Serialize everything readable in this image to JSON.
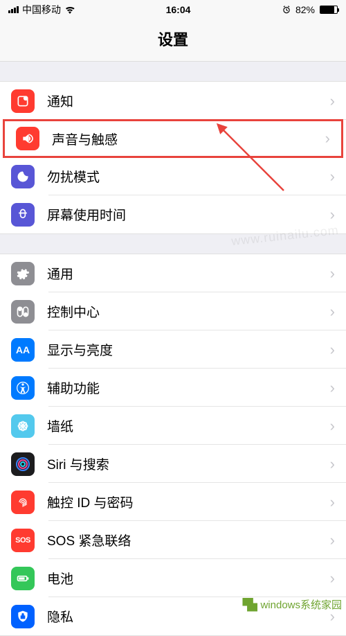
{
  "status": {
    "carrier": "中国移动",
    "time": "16:04",
    "battery_pct": "82%"
  },
  "nav": {
    "title": "设置"
  },
  "group1": [
    {
      "label": "通知",
      "icon": "notifications-icon",
      "color": "ic-red"
    },
    {
      "label": "声音与触感",
      "icon": "sound-icon",
      "color": "ic-red",
      "highlight": true
    },
    {
      "label": "勿扰模式",
      "icon": "dnd-icon",
      "color": "ic-purple"
    },
    {
      "label": "屏幕使用时间",
      "icon": "screentime-icon",
      "color": "ic-purple"
    }
  ],
  "group2": [
    {
      "label": "通用",
      "icon": "general-icon",
      "color": "ic-gray"
    },
    {
      "label": "控制中心",
      "icon": "control-center-icon",
      "color": "ic-gray"
    },
    {
      "label": "显示与亮度",
      "icon": "display-icon",
      "color": "ic-blue"
    },
    {
      "label": "辅助功能",
      "icon": "accessibility-icon",
      "color": "ic-blue"
    },
    {
      "label": "墙纸",
      "icon": "wallpaper-icon",
      "color": "ic-cyan"
    },
    {
      "label": "Siri 与搜索",
      "icon": "siri-icon",
      "color": "ic-dark"
    },
    {
      "label": "触控 ID 与密码",
      "icon": "touchid-icon",
      "color": "ic-red"
    },
    {
      "label": "SOS 紧急联络",
      "icon": "sos-icon",
      "color": "ic-sos",
      "text_icon": "SOS"
    },
    {
      "label": "电池",
      "icon": "battery-icon",
      "color": "ic-green"
    },
    {
      "label": "隐私",
      "icon": "privacy-icon",
      "color": "ic-strong-blue"
    }
  ],
  "watermark_center": "www.ruinailu.com",
  "footer_text": "windows系统家园"
}
